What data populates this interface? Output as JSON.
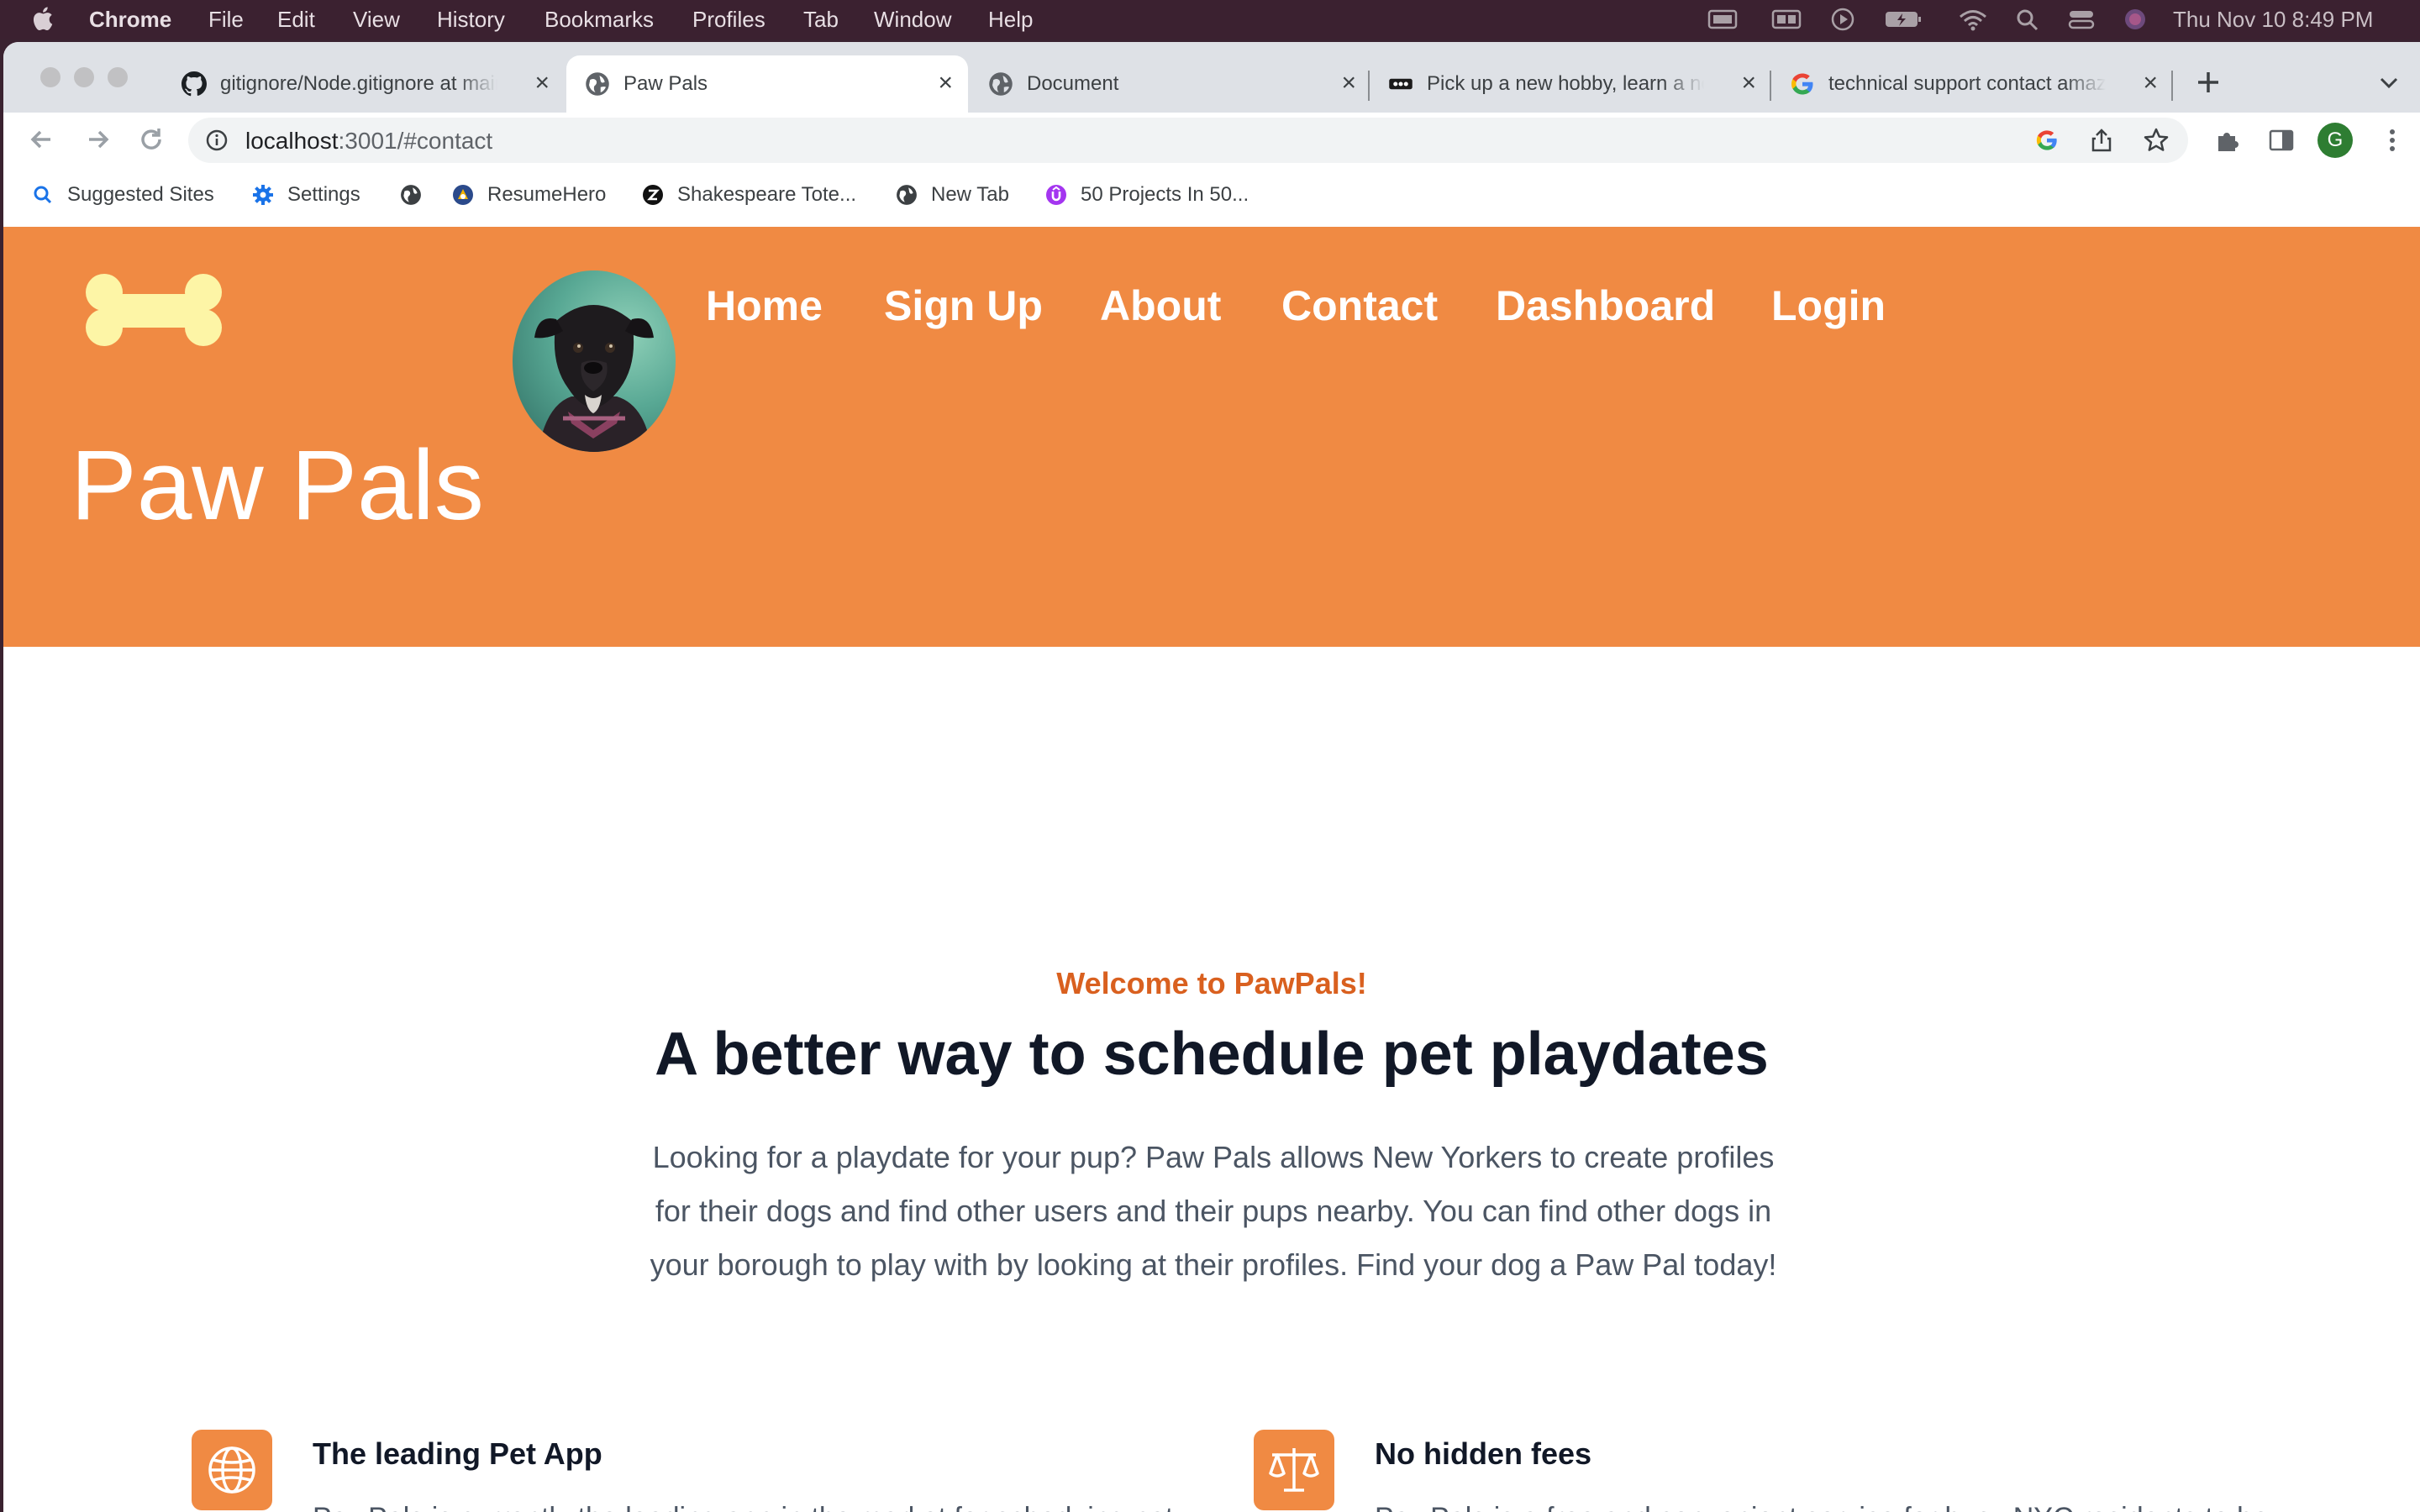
{
  "menubar": {
    "app": "Chrome",
    "items": [
      "File",
      "Edit",
      "View",
      "History",
      "Bookmarks",
      "Profiles",
      "Tab",
      "Window",
      "Help"
    ],
    "clock": "Thu Nov 10  8:49 PM"
  },
  "tabs": [
    {
      "title": "gitignore/Node.gitignore at main",
      "icon": "github-icon"
    },
    {
      "title": "Paw Pals",
      "icon": "globe-icon",
      "active": true
    },
    {
      "title": "Document",
      "icon": "globe-icon"
    },
    {
      "title": "Pick up a new hobby, learn a new skill",
      "icon": "meetup-icon"
    },
    {
      "title": "technical support contact amazon",
      "icon": "google-icon"
    }
  ],
  "toolbar": {
    "url_host": "localhost",
    "url_path": ":3001/#contact",
    "profile_initial": "G"
  },
  "bookmarks": [
    {
      "label": "Suggested Sites",
      "icon": "search-icon"
    },
    {
      "label": "Settings",
      "icon": "gear-icon"
    },
    {
      "label": "",
      "icon": "globe-icon"
    },
    {
      "label": "ResumeHero",
      "icon": "resumehero-icon"
    },
    {
      "label": "Shakespeare Tote...",
      "icon": "zazzle-icon"
    },
    {
      "label": "New Tab",
      "icon": "globe-icon"
    },
    {
      "label": "50 Projects In 50...",
      "icon": "udemy-icon"
    }
  ],
  "site": {
    "brand": "Paw Pals",
    "nav": [
      "Home",
      "Sign Up",
      "About",
      "Contact",
      "Dashboard",
      "Login"
    ],
    "welcome": "Welcome to PawPals!",
    "headline": "A better way to schedule pet playdates",
    "lead": "Looking for a playdate for your pup? Paw Pals allows New Yorkers to create profiles for their dogs and find other users and their pups nearby. You can find other dogs in your borough to play with by looking at their profiles. Find your dog a Paw Pal today!",
    "features": [
      {
        "title": "The leading Pet App",
        "text": "PawPals is currently the leading app in the market for scheduing pet",
        "icon": "globe-icon"
      },
      {
        "title": "No hidden fees",
        "text": "PawPals is a free and convenient service for busy NYC residents to be",
        "icon": "scale-icon"
      }
    ]
  },
  "colors": {
    "hero": "#f08a43",
    "accent_text": "#d9601f",
    "bone": "#fdf5a6"
  }
}
